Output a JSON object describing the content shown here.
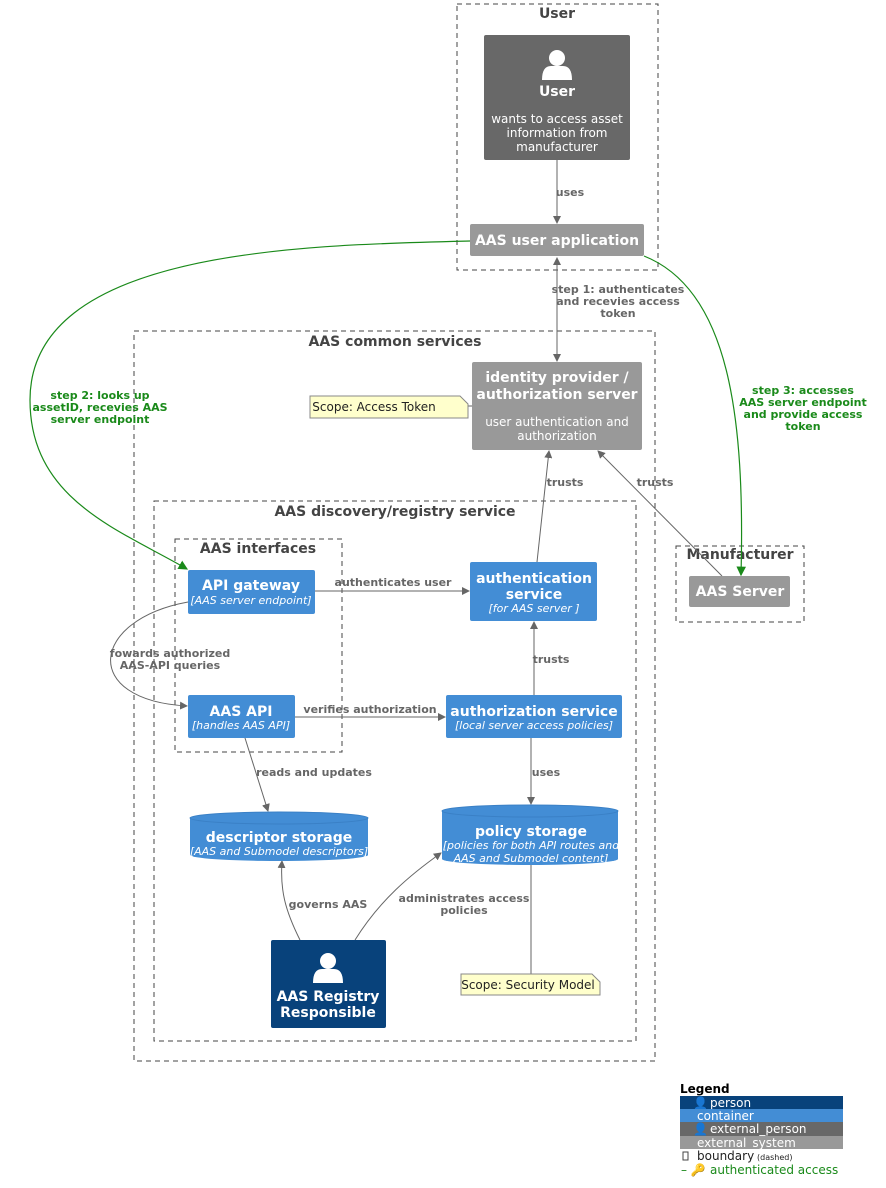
{
  "colors": {
    "person": "#08427b",
    "container": "#438dd5",
    "external_person": "#686868",
    "external_system": "#999999",
    "authenticated": "#1a8a1a"
  },
  "boundaries": {
    "user": "User",
    "common": "AAS common services",
    "discovery": "AAS discovery/registry service",
    "interfaces": "AAS interfaces",
    "manufacturer": "Manufacturer"
  },
  "nodes": {
    "user": {
      "title": "User",
      "desc": [
        "wants to access asset",
        "information from",
        "manufacturer"
      ]
    },
    "user_app": {
      "title": "AAS user application"
    },
    "idp": {
      "title": [
        "identity provider /",
        "authorization server"
      ],
      "desc": [
        "user authentication and",
        "authorization"
      ]
    },
    "api_gateway": {
      "title": "API gateway",
      "sub": "[AAS server endpoint]"
    },
    "authn": {
      "title": [
        "authentication",
        "service"
      ],
      "sub": "[for AAS server ]"
    },
    "aas_api": {
      "title": "AAS API",
      "sub": "[handles AAS API]"
    },
    "authz": {
      "title": "authorization service",
      "sub": "[local server access  policies]"
    },
    "descriptor": {
      "title": "descriptor storage",
      "sub": "[AAS and Submodel descriptors]"
    },
    "policy": {
      "title": "policy storage",
      "sub": [
        "[policies for both API routes and",
        "AAS and Submodel content]"
      ]
    },
    "registry": {
      "title": [
        "AAS Registry",
        "Responsible"
      ]
    },
    "aas_server": {
      "title": "AAS Server"
    }
  },
  "notes": {
    "access_token": "Scope: Access Token",
    "security_model": "Scope: Security Model"
  },
  "edges": {
    "uses1": "uses",
    "step1": [
      "step 1: authenticates",
      "and recevies access",
      "token"
    ],
    "step2": [
      "step 2: looks up",
      "assetID, recevies AAS",
      "server endpoint"
    ],
    "step3": [
      "step 3: accesses",
      "AAS server endpoint",
      "and provide access",
      "token"
    ],
    "authenticates": "authenticates user",
    "forwards": [
      "fowards authorized",
      "AAS-API queries"
    ],
    "verifies": "verifies authorization",
    "trusts1": "trusts",
    "trusts2": "trusts",
    "trusts3": "trusts",
    "uses2": "uses",
    "reads": "reads and updates",
    "governs": "governs AAS",
    "administrates": [
      "administrates access",
      "policies"
    ]
  },
  "legend": {
    "title": "Legend",
    "items": [
      "person",
      "container",
      "external_person",
      "external_system"
    ],
    "boundary": "boundary",
    "boundary_note": "(dashed)",
    "auth": "authenticated access"
  }
}
